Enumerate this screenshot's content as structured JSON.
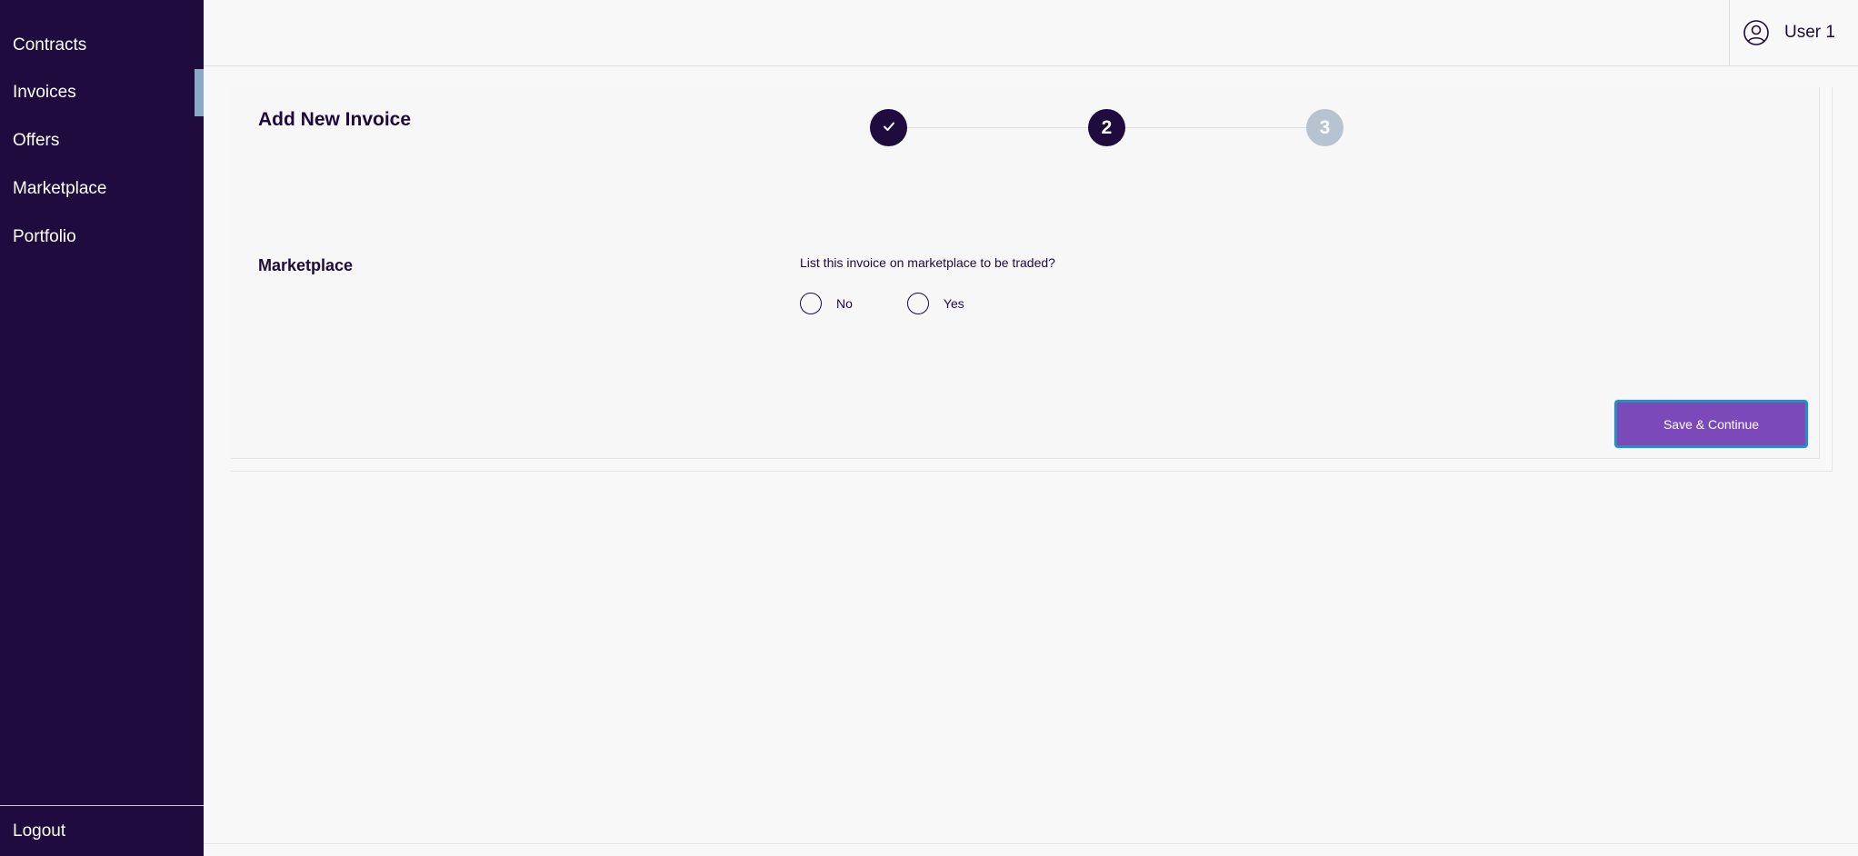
{
  "sidebar": {
    "items": [
      {
        "label": "Contracts"
      },
      {
        "label": "Invoices"
      },
      {
        "label": "Offers"
      },
      {
        "label": "Marketplace"
      },
      {
        "label": "Portfolio"
      }
    ],
    "active_item": "Invoices",
    "logout_label": "Logout"
  },
  "header": {
    "user_label": "User 1",
    "user_icon": "user-circle-icon"
  },
  "main": {
    "title": "Add New Invoice",
    "stepper": {
      "steps": [
        {
          "label": "",
          "status": "completed",
          "icon": "check-icon"
        },
        {
          "label": "2",
          "status": "current"
        },
        {
          "label": "3",
          "status": "pending"
        }
      ]
    },
    "section": {
      "label": "Marketplace",
      "question": "List this invoice on marketplace to be traded?",
      "options": [
        {
          "label": "No",
          "selected": false
        },
        {
          "label": "Yes",
          "selected": false
        }
      ]
    },
    "save_button_label": "Save & Continue"
  },
  "colors": {
    "sidebar_bg": "#200b3f",
    "accent": "#7b49b8",
    "focus_ring": "#2a8dc2",
    "pending_step": "#b8c3d2",
    "active_indicator": "#8aa9c6"
  }
}
